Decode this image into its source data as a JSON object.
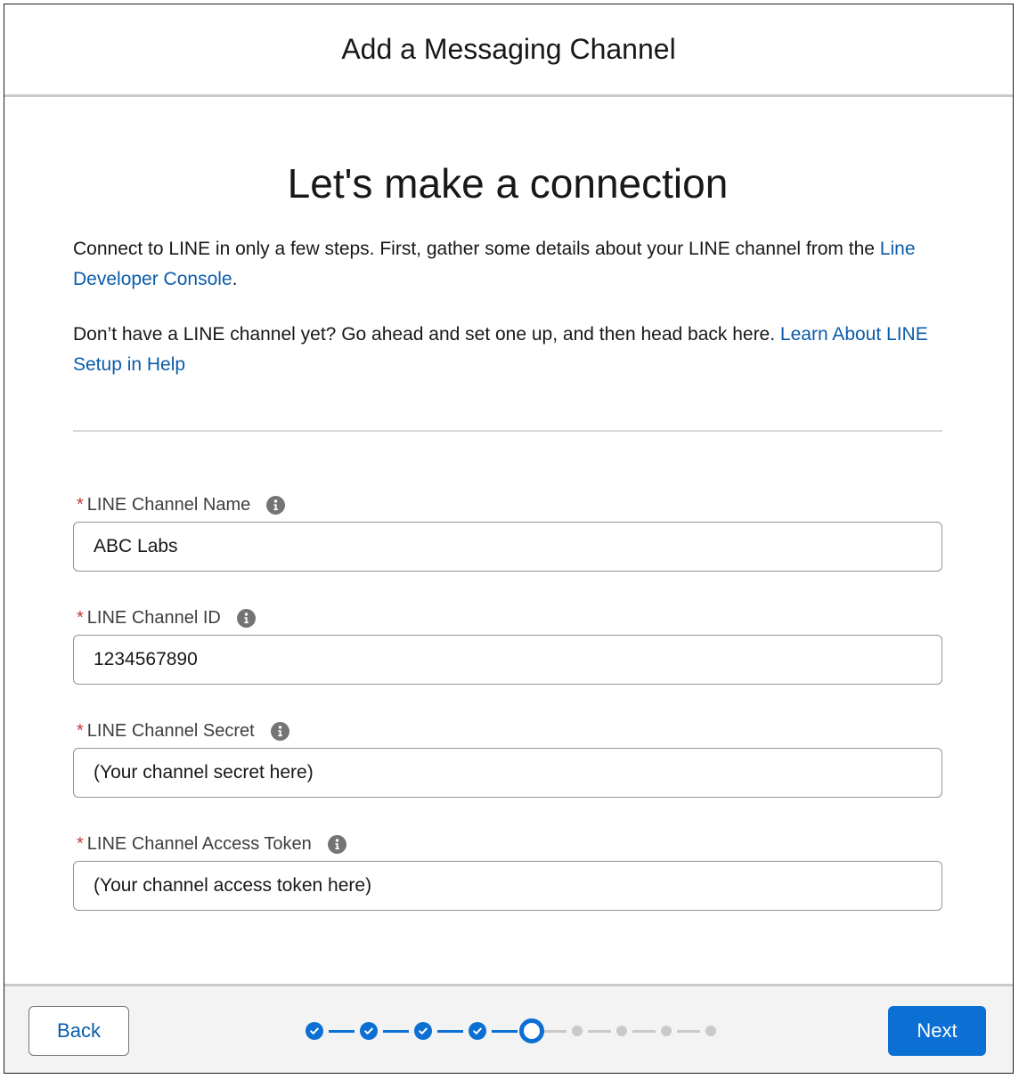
{
  "modal": {
    "title": "Add a Messaging Channel"
  },
  "main": {
    "heading": "Let's make a connection",
    "intro": {
      "text_before": "Connect to LINE in only a few steps. First, gather some details about your LINE channel from the ",
      "link": "Line Developer Console",
      "text_after": "."
    },
    "note": {
      "text_before": "Don’t have a LINE channel yet? Go ahead and set one up, and then head back here. ",
      "link": "Learn About LINE Setup in Help"
    }
  },
  "form": {
    "required_marker": "*",
    "fields": [
      {
        "label": "LINE Channel Name",
        "value": "ABC Labs"
      },
      {
        "label": "LINE Channel ID",
        "value": "1234567890"
      },
      {
        "label": "LINE Channel Secret",
        "value": "(Your channel secret here)"
      },
      {
        "label": "LINE Channel Access Token",
        "value": "(Your channel access token here)"
      }
    ]
  },
  "footer": {
    "back_label": "Back",
    "next_label": "Next",
    "progress": {
      "total_steps": 9,
      "current_step": 5,
      "completed_steps": 4
    }
  },
  "colors": {
    "brand_blue": "#0b6fd3",
    "link_blue": "#0b5cab",
    "required_red": "#c23934",
    "inactive_step": "#c9c9c9"
  },
  "icons": {
    "info": "info-icon",
    "check": "check-icon"
  }
}
